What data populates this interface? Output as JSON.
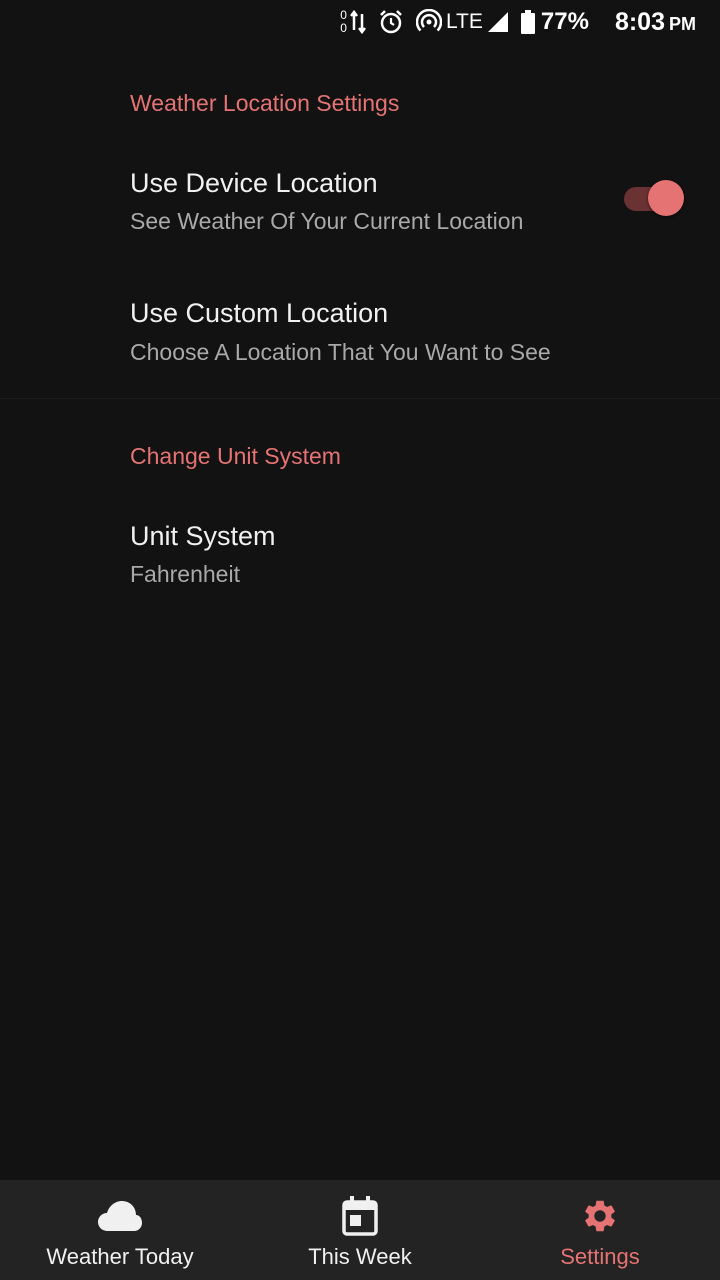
{
  "status_bar": {
    "data_up": "0",
    "data_down": "0",
    "network": "LTE",
    "battery": "77%",
    "time": "8:03",
    "ampm": "PM"
  },
  "sections": {
    "location": {
      "title": "Weather Location Settings",
      "device_location": {
        "title": "Use Device Location",
        "summary": "See Weather Of Your Current Location",
        "enabled": true
      },
      "custom_location": {
        "title": "Use Custom Location",
        "summary": "Choose A Location That You Want to See"
      }
    },
    "units": {
      "title": "Change Unit System",
      "unit_system": {
        "title": "Unit System",
        "summary": "Fahrenheit"
      }
    }
  },
  "bottom_nav": {
    "items": [
      {
        "label": "Weather Today",
        "icon": "cloud-icon",
        "active": false
      },
      {
        "label": "This Week",
        "icon": "calendar-icon",
        "active": false
      },
      {
        "label": "Settings",
        "icon": "gear-icon",
        "active": true
      }
    ]
  },
  "colors": {
    "accent": "#e57373",
    "background": "#121212",
    "nav_background": "#232323",
    "summary_text": "#a9a9a9"
  }
}
